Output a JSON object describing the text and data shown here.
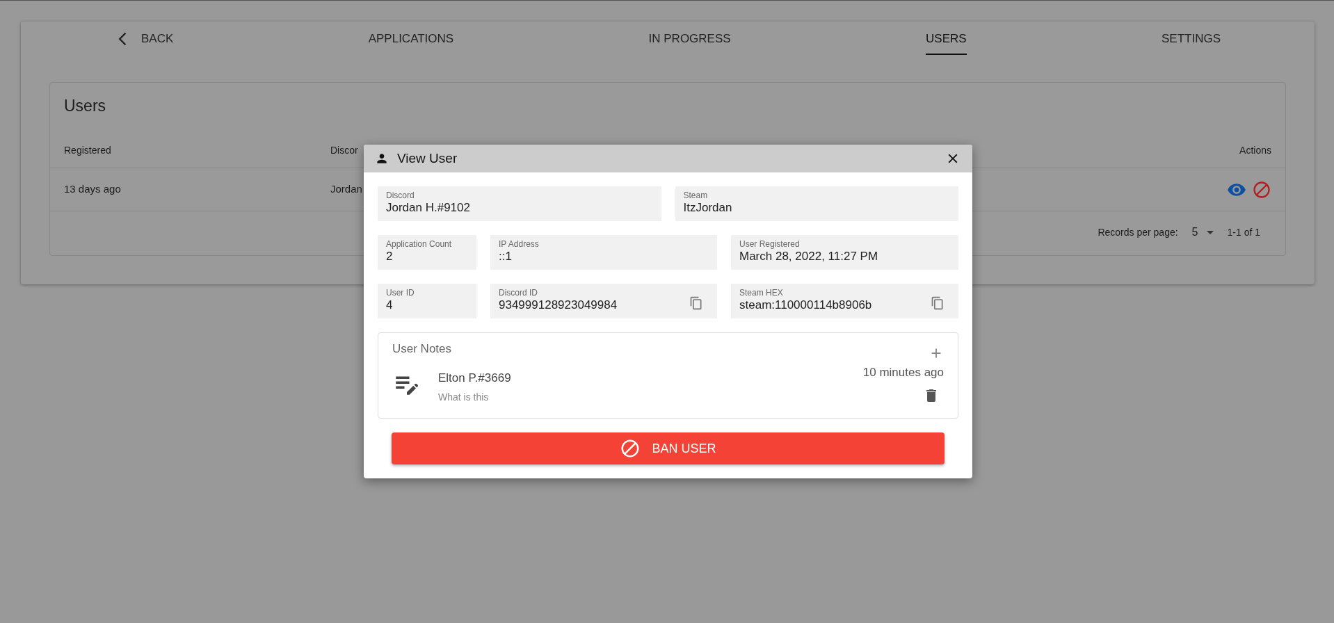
{
  "nav": {
    "back": "BACK",
    "tabs": [
      {
        "label": "APPLICATIONS",
        "selected": false
      },
      {
        "label": "IN PROGRESS",
        "selected": false
      },
      {
        "label": "USERS",
        "selected": true
      },
      {
        "label": "SETTINGS",
        "selected": false
      }
    ]
  },
  "users_table": {
    "title": "Users",
    "columns": [
      "Registered",
      "Discor",
      "Actions"
    ],
    "rows": [
      {
        "registered": "13 days ago",
        "discord": "Jordan"
      }
    ],
    "footer": {
      "records_label": "Records per page:",
      "records_value": "5",
      "range": "1-1 of 1"
    }
  },
  "dialog": {
    "title": "View User",
    "field_rows": [
      [
        {
          "label": "Discord",
          "value": "Jordan H.#9102",
          "copy": false
        },
        {
          "label": "Steam",
          "value": "ItzJordan",
          "copy": false
        }
      ],
      [
        {
          "label": "Application Count",
          "value": "2",
          "copy": false
        },
        {
          "label": "IP Address",
          "value": "::1",
          "copy": false
        },
        {
          "label": "User Registered",
          "value": "March 28, 2022, 11:27 PM",
          "copy": false
        }
      ],
      [
        {
          "label": "User ID",
          "value": "4",
          "copy": false
        },
        {
          "label": "Discord ID",
          "value": "934999128923049984",
          "copy": true
        },
        {
          "label": "Steam HEX",
          "value": "steam:110000114b8906b",
          "copy": true
        }
      ]
    ],
    "notes": {
      "title": "User Notes",
      "items": [
        {
          "author": "Elton P.#3669",
          "text": "What is this",
          "time": "10 minutes ago"
        }
      ]
    },
    "ban_button": "BAN USER"
  }
}
